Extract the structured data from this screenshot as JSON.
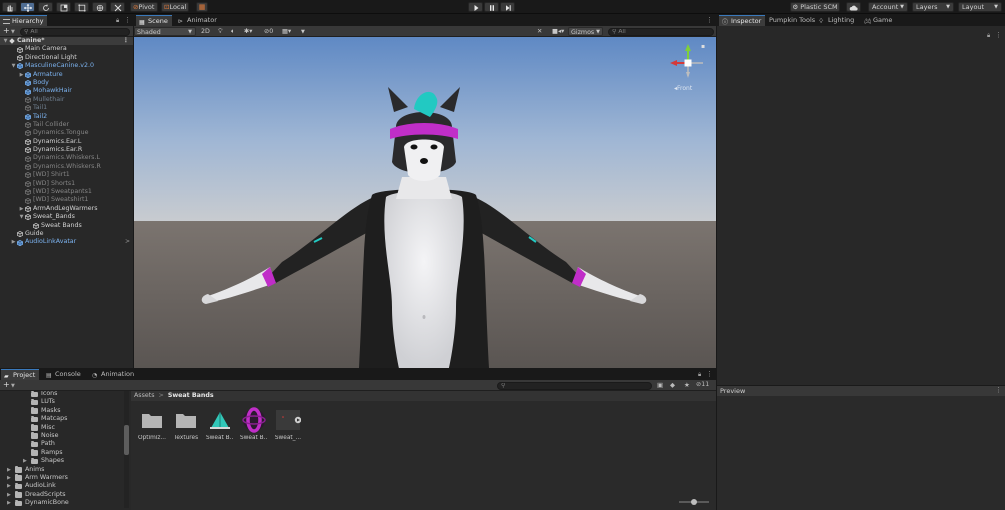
{
  "toolbar": {
    "pivot_label": "Pivot",
    "local_label": "Local",
    "plastic_label": "Plastic SCM",
    "account_label": "Account",
    "layers_label": "Layers",
    "layout_label": "Layout"
  },
  "hierarchy": {
    "tab_label": "Hierarchy",
    "search_placeholder": "All",
    "items": [
      {
        "label": "Canine*",
        "depth": 0,
        "kind": "root",
        "color": "white",
        "arrow": "open"
      },
      {
        "label": "Main Camera",
        "depth": 1,
        "color": "white"
      },
      {
        "label": "Directional Light",
        "depth": 1,
        "color": "white"
      },
      {
        "label": "MasculineCanine.v2.0",
        "depth": 1,
        "color": "blue",
        "arrow": "open"
      },
      {
        "label": "Armature",
        "depth": 2,
        "color": "blue",
        "arrow": "closed"
      },
      {
        "label": "Body",
        "depth": 2,
        "color": "blue"
      },
      {
        "label": "MohawkHair",
        "depth": 2,
        "color": "blue"
      },
      {
        "label": "Mullethair",
        "depth": 2,
        "color": "dim"
      },
      {
        "label": "Tail1",
        "depth": 2,
        "color": "dim"
      },
      {
        "label": "Tail2",
        "depth": 2,
        "color": "blue"
      },
      {
        "label": "Tail Collider",
        "depth": 2,
        "color": "gray"
      },
      {
        "label": "Dynamics.Tongue",
        "depth": 2,
        "color": "gray"
      },
      {
        "label": "Dynamics.Ear.L",
        "depth": 2,
        "color": "white"
      },
      {
        "label": "Dynamics.Ear.R",
        "depth": 2,
        "color": "white"
      },
      {
        "label": "Dynamics.Whiskers.L",
        "depth": 2,
        "color": "gray"
      },
      {
        "label": "Dynamics.Whiskers.R",
        "depth": 2,
        "color": "gray"
      },
      {
        "label": "[WD] Shirt1",
        "depth": 2,
        "color": "gray"
      },
      {
        "label": "[WD] Shorts1",
        "depth": 2,
        "color": "gray"
      },
      {
        "label": "[WD] Sweatpants1",
        "depth": 2,
        "color": "gray"
      },
      {
        "label": "[WD] Sweatshirt1",
        "depth": 2,
        "color": "gray"
      },
      {
        "label": "ArmAndLegWarmers",
        "depth": 2,
        "color": "white",
        "arrow": "closed"
      },
      {
        "label": "Sweat_Bands",
        "depth": 2,
        "color": "white",
        "arrow": "open"
      },
      {
        "label": "Sweat Bands",
        "depth": 3,
        "color": "white"
      },
      {
        "label": "Guide",
        "depth": 1,
        "color": "white"
      },
      {
        "label": "AudioLinkAvatar",
        "depth": 1,
        "color": "blue",
        "arrow": "closed",
        "chevron": true
      }
    ]
  },
  "scene": {
    "tab_scene": "Scene",
    "tab_animator": "Animator",
    "shading_mode": "Shaded",
    "toggle_2d": "2D",
    "hidden_count": "0",
    "gizmos_label": "Gizmos",
    "search_placeholder": "All",
    "view_label": "Front"
  },
  "inspector": {
    "tabs": [
      "Inspector",
      "Pumpkin Tools",
      "Lighting",
      "Game"
    ],
    "preview_label": "Preview"
  },
  "project": {
    "tabs": [
      "Project",
      "Console",
      "Animation"
    ],
    "hidden_count": "11",
    "folders": [
      {
        "label": "Icons",
        "depth": 2
      },
      {
        "label": "LUTs",
        "depth": 2
      },
      {
        "label": "Masks",
        "depth": 2
      },
      {
        "label": "Matcaps",
        "depth": 2
      },
      {
        "label": "Misc",
        "depth": 2
      },
      {
        "label": "Noise",
        "depth": 2
      },
      {
        "label": "Path",
        "depth": 2
      },
      {
        "label": "Ramps",
        "depth": 2
      },
      {
        "label": "Shapes",
        "depth": 2,
        "arrow": "closed"
      },
      {
        "label": "Anims",
        "depth": 0,
        "arrow": "closed"
      },
      {
        "label": "Arm Warmers",
        "depth": 0,
        "arrow": "closed"
      },
      {
        "label": "AudioLink",
        "depth": 0,
        "arrow": "closed"
      },
      {
        "label": "DreadScripts",
        "depth": 0,
        "arrow": "closed"
      },
      {
        "label": "DynamicBone",
        "depth": 0,
        "arrow": "closed"
      }
    ],
    "breadcrumb_root": "Assets",
    "breadcrumb_sep": ">",
    "breadcrumb_current": "Sweat Bands",
    "assets": [
      {
        "name": "Optimiz...",
        "kind": "folder"
      },
      {
        "name": "Textures",
        "kind": "folder"
      },
      {
        "name": "Sweat B...",
        "kind": "mesh"
      },
      {
        "name": "Sweat B...",
        "kind": "material"
      },
      {
        "name": "Sweat_...",
        "kind": "prefab"
      }
    ]
  },
  "colors": {
    "accent": "#3a79bb",
    "band_magenta": "#c02ec8",
    "hair_teal": "#22c9c2",
    "sky_top": "#5e8ac6",
    "ground": "#6a6460"
  }
}
